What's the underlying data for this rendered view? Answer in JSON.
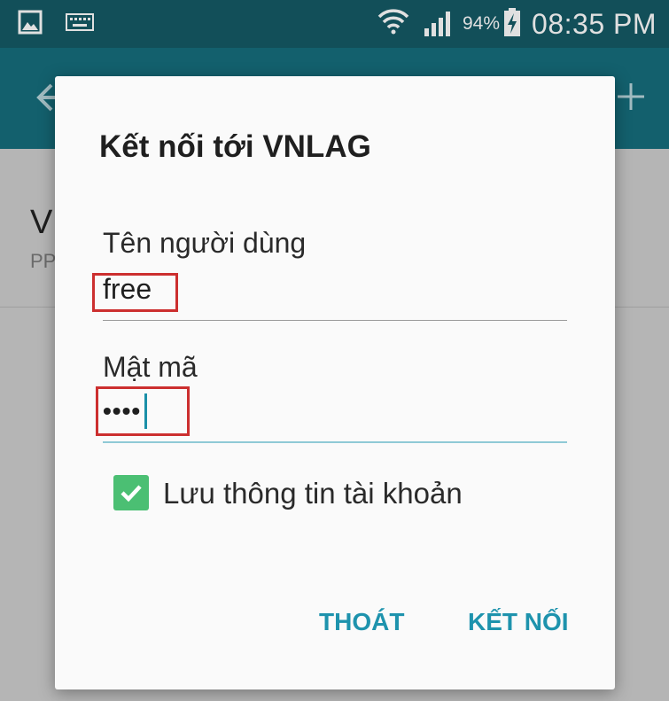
{
  "status_bar": {
    "icons": [
      "gallery-icon",
      "keyboard-icon",
      "wifi-icon",
      "signal-icon",
      "battery-charging-icon"
    ],
    "battery_percent": "94%",
    "time": "08:35 PM"
  },
  "action_bar": {
    "back_icon": "back-arrow-icon",
    "add_icon": "plus-icon"
  },
  "background_list": {
    "item_title": "V",
    "item_subtitle": "PP"
  },
  "dialog": {
    "title": "Kết nối tới VNLAG",
    "username": {
      "label": "Tên người dùng",
      "value": "free"
    },
    "password": {
      "label": "Mật mã",
      "value": "••••"
    },
    "save_checkbox": {
      "label": "Lưu thông tin tài khoản",
      "checked": true
    },
    "buttons": {
      "cancel": "THOÁT",
      "connect": "KẾT NỐI"
    }
  },
  "colors": {
    "status_bar": "#155a66",
    "action_bar": "#166e7d",
    "accent": "#1e93ad",
    "checkbox": "#4bbf73",
    "highlight": "#cc2f2f"
  }
}
